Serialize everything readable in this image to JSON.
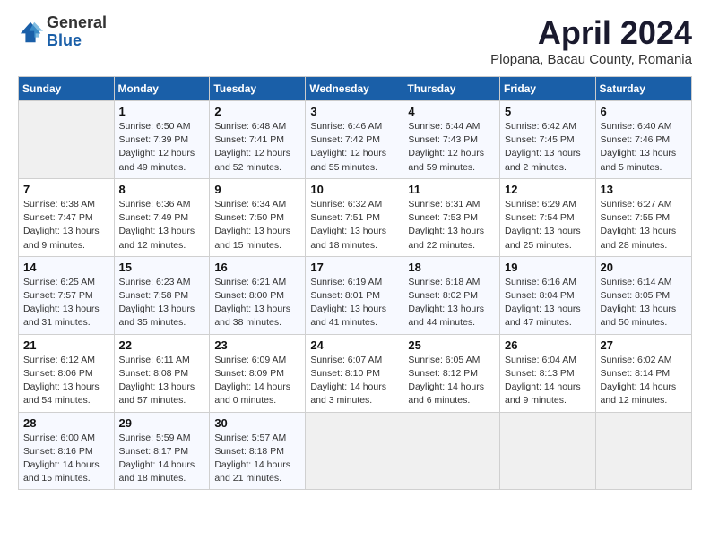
{
  "header": {
    "logo": {
      "general": "General",
      "blue": "Blue"
    },
    "title": "April 2024",
    "subtitle": "Plopana, Bacau County, Romania"
  },
  "days_of_week": [
    "Sunday",
    "Monday",
    "Tuesday",
    "Wednesday",
    "Thursday",
    "Friday",
    "Saturday"
  ],
  "weeks": [
    [
      null,
      {
        "day": 1,
        "sunrise": "6:50 AM",
        "sunset": "7:39 PM",
        "daylight": "12 hours and 49 minutes."
      },
      {
        "day": 2,
        "sunrise": "6:48 AM",
        "sunset": "7:41 PM",
        "daylight": "12 hours and 52 minutes."
      },
      {
        "day": 3,
        "sunrise": "6:46 AM",
        "sunset": "7:42 PM",
        "daylight": "12 hours and 55 minutes."
      },
      {
        "day": 4,
        "sunrise": "6:44 AM",
        "sunset": "7:43 PM",
        "daylight": "12 hours and 59 minutes."
      },
      {
        "day": 5,
        "sunrise": "6:42 AM",
        "sunset": "7:45 PM",
        "daylight": "13 hours and 2 minutes."
      },
      {
        "day": 6,
        "sunrise": "6:40 AM",
        "sunset": "7:46 PM",
        "daylight": "13 hours and 5 minutes."
      }
    ],
    [
      {
        "day": 7,
        "sunrise": "6:38 AM",
        "sunset": "7:47 PM",
        "daylight": "13 hours and 9 minutes."
      },
      {
        "day": 8,
        "sunrise": "6:36 AM",
        "sunset": "7:49 PM",
        "daylight": "13 hours and 12 minutes."
      },
      {
        "day": 9,
        "sunrise": "6:34 AM",
        "sunset": "7:50 PM",
        "daylight": "13 hours and 15 minutes."
      },
      {
        "day": 10,
        "sunrise": "6:32 AM",
        "sunset": "7:51 PM",
        "daylight": "13 hours and 18 minutes."
      },
      {
        "day": 11,
        "sunrise": "6:31 AM",
        "sunset": "7:53 PM",
        "daylight": "13 hours and 22 minutes."
      },
      {
        "day": 12,
        "sunrise": "6:29 AM",
        "sunset": "7:54 PM",
        "daylight": "13 hours and 25 minutes."
      },
      {
        "day": 13,
        "sunrise": "6:27 AM",
        "sunset": "7:55 PM",
        "daylight": "13 hours and 28 minutes."
      }
    ],
    [
      {
        "day": 14,
        "sunrise": "6:25 AM",
        "sunset": "7:57 PM",
        "daylight": "13 hours and 31 minutes."
      },
      {
        "day": 15,
        "sunrise": "6:23 AM",
        "sunset": "7:58 PM",
        "daylight": "13 hours and 35 minutes."
      },
      {
        "day": 16,
        "sunrise": "6:21 AM",
        "sunset": "8:00 PM",
        "daylight": "13 hours and 38 minutes."
      },
      {
        "day": 17,
        "sunrise": "6:19 AM",
        "sunset": "8:01 PM",
        "daylight": "13 hours and 41 minutes."
      },
      {
        "day": 18,
        "sunrise": "6:18 AM",
        "sunset": "8:02 PM",
        "daylight": "13 hours and 44 minutes."
      },
      {
        "day": 19,
        "sunrise": "6:16 AM",
        "sunset": "8:04 PM",
        "daylight": "13 hours and 47 minutes."
      },
      {
        "day": 20,
        "sunrise": "6:14 AM",
        "sunset": "8:05 PM",
        "daylight": "13 hours and 50 minutes."
      }
    ],
    [
      {
        "day": 21,
        "sunrise": "6:12 AM",
        "sunset": "8:06 PM",
        "daylight": "13 hours and 54 minutes."
      },
      {
        "day": 22,
        "sunrise": "6:11 AM",
        "sunset": "8:08 PM",
        "daylight": "13 hours and 57 minutes."
      },
      {
        "day": 23,
        "sunrise": "6:09 AM",
        "sunset": "8:09 PM",
        "daylight": "14 hours and 0 minutes."
      },
      {
        "day": 24,
        "sunrise": "6:07 AM",
        "sunset": "8:10 PM",
        "daylight": "14 hours and 3 minutes."
      },
      {
        "day": 25,
        "sunrise": "6:05 AM",
        "sunset": "8:12 PM",
        "daylight": "14 hours and 6 minutes."
      },
      {
        "day": 26,
        "sunrise": "6:04 AM",
        "sunset": "8:13 PM",
        "daylight": "14 hours and 9 minutes."
      },
      {
        "day": 27,
        "sunrise": "6:02 AM",
        "sunset": "8:14 PM",
        "daylight": "14 hours and 12 minutes."
      }
    ],
    [
      {
        "day": 28,
        "sunrise": "6:00 AM",
        "sunset": "8:16 PM",
        "daylight": "14 hours and 15 minutes."
      },
      {
        "day": 29,
        "sunrise": "5:59 AM",
        "sunset": "8:17 PM",
        "daylight": "14 hours and 18 minutes."
      },
      {
        "day": 30,
        "sunrise": "5:57 AM",
        "sunset": "8:18 PM",
        "daylight": "14 hours and 21 minutes."
      },
      null,
      null,
      null,
      null
    ]
  ]
}
